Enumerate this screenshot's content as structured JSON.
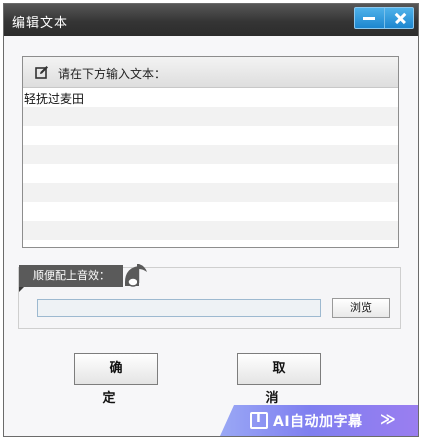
{
  "window": {
    "title": "编辑文本"
  },
  "editor": {
    "prompt": "请在下方输入文本：",
    "text": "轻抚过麦田"
  },
  "sound": {
    "label": "顺便配上音效：",
    "path_value": "",
    "browse_label": "浏览"
  },
  "buttons": {
    "ok_label": "确 定",
    "cancel_label": "取 消"
  },
  "ai_banner": {
    "label": "AI自动加字幕",
    "arrow": "≫"
  },
  "colors": {
    "titlebar": "#353535",
    "accent_blue": "#1d86cf",
    "banner_purple": "#7f7ff0"
  }
}
